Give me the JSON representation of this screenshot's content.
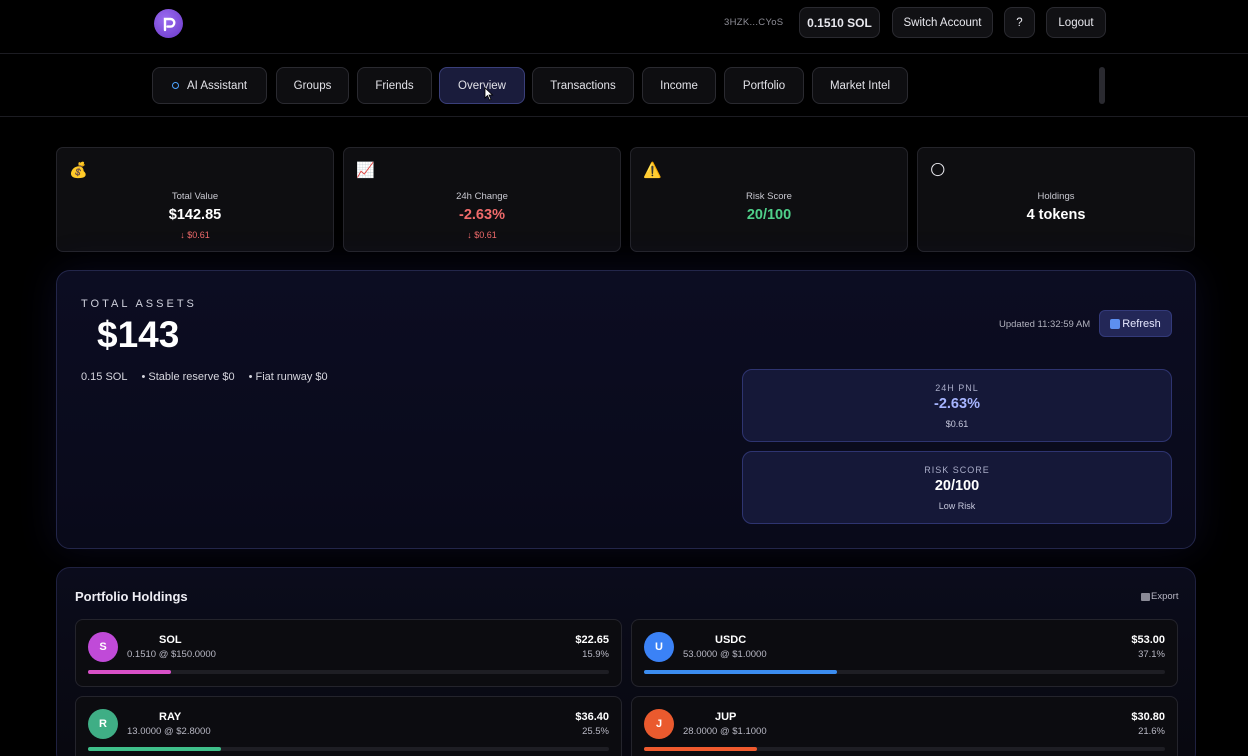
{
  "header": {
    "wallet_address": "3HZK...CYoS",
    "sol_balance": "0.1510 SOL",
    "switch_account_label": "Switch Account",
    "help_label": "?",
    "logout_label": "Logout"
  },
  "tabs": [
    {
      "label": "AI Assistant",
      "active": false
    },
    {
      "label": "Groups",
      "active": false
    },
    {
      "label": "Friends",
      "active": false
    },
    {
      "label": "Overview",
      "active": true
    },
    {
      "label": "Transactions",
      "active": false
    },
    {
      "label": "Income",
      "active": false
    },
    {
      "label": "Portfolio",
      "active": false
    },
    {
      "label": "Market Intel",
      "active": false
    }
  ],
  "stats": [
    {
      "icon": "money-bag-icon",
      "emoji": "💰",
      "label": "Total Value",
      "value": "$142.85",
      "sub": "↓ $0.61"
    },
    {
      "icon": "chart-up-icon",
      "emoji": "📈",
      "label": "24h Change",
      "value": "-2.63%",
      "sub": "↓ $0.61"
    },
    {
      "icon": "warning-icon",
      "emoji": "⚠️",
      "label": "Risk Score",
      "value": "20/100",
      "sub": ""
    },
    {
      "icon": "moon-icon",
      "emoji": "🌕",
      "label": "Holdings",
      "value": "4 tokens",
      "sub": ""
    }
  ],
  "total_assets": {
    "label": "TOTAL ASSETS",
    "value": "$143",
    "breakdown": [
      "0.15 SOL",
      "• Stable reserve $0",
      "• Fiat runway $0"
    ],
    "updated": "Updated 11:32:59 AM",
    "refresh_label": "Refresh",
    "pnl": {
      "label": "24H PNL",
      "value": "-2.63%",
      "sub": "$0.61"
    },
    "risk": {
      "label": "RISK SCORE",
      "value": "20/100",
      "sub": "Low Risk"
    }
  },
  "holdings": {
    "title": "Portfolio Holdings",
    "export_label": "Export",
    "tokens": [
      {
        "initial": "S",
        "symbol": "SOL",
        "qty": "0.1510 @ $150.0000",
        "value": "$22.65",
        "pct": "15.9%",
        "share": 0.159,
        "color": "#c04ad8",
        "bar": "#d850c8"
      },
      {
        "initial": "U",
        "symbol": "USDC",
        "qty": "53.0000 @ $1.0000",
        "value": "$53.00",
        "pct": "37.1%",
        "share": 0.371,
        "color": "#3b82f6",
        "bar": "#3b8cf0"
      },
      {
        "initial": "R",
        "symbol": "RAY",
        "qty": "13.0000 @ $2.8000",
        "value": "$36.40",
        "pct": "25.5%",
        "share": 0.255,
        "color": "#3fae85",
        "bar": "#3fbf8a"
      },
      {
        "initial": "J",
        "symbol": "JUP",
        "qty": "28.0000 @ $1.1000",
        "value": "$30.80",
        "pct": "21.6%",
        "share": 0.216,
        "color": "#ea5a2e",
        "bar": "#ef5a2e"
      }
    ]
  }
}
